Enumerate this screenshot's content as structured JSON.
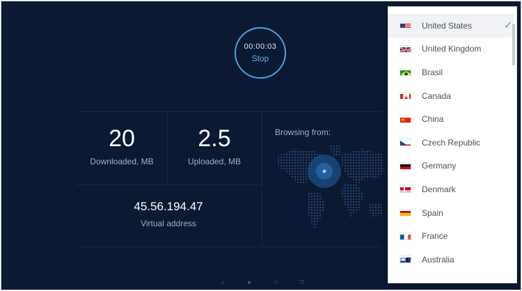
{
  "timer": {
    "time": "00:00:03",
    "stop_label": "Stop"
  },
  "stats": {
    "downloaded_value": "20",
    "downloaded_label": "Downloaded, MB",
    "uploaded_value": "2.5",
    "uploaded_label": "Uploaded, MB",
    "ip": "45.56.194.47",
    "ip_label": "Virtual address"
  },
  "browsing_from_label": "Browsing from:",
  "countries": [
    {
      "name": "United States",
      "flag": "us-flag-icon",
      "selected": true
    },
    {
      "name": "United Kingdom",
      "flag": "uk-flag-icon",
      "selected": false
    },
    {
      "name": "Brasil",
      "flag": "brazil-flag-icon",
      "selected": false
    },
    {
      "name": "Canada",
      "flag": "canada-flag-icon",
      "selected": false
    },
    {
      "name": "China",
      "flag": "china-flag-icon",
      "selected": false
    },
    {
      "name": "Czech Republic",
      "flag": "czech-flag-icon",
      "selected": false
    },
    {
      "name": "Germany",
      "flag": "germany-flag-icon",
      "selected": false
    },
    {
      "name": "Denmark",
      "flag": "denmark-flag-icon",
      "selected": false
    },
    {
      "name": "Spain",
      "flag": "spain-flag-icon",
      "selected": false
    },
    {
      "name": "France",
      "flag": "france-flag-icon",
      "selected": false
    },
    {
      "name": "Australia",
      "flag": "australia-flag-icon",
      "selected": false
    }
  ],
  "bottom_nav": [
    {
      "icon": "home-icon"
    },
    {
      "icon": "user-icon"
    },
    {
      "icon": "star-icon"
    },
    {
      "icon": "shield-icon"
    }
  ],
  "colors": {
    "background": "#0b1933",
    "accent": "#4aa3df",
    "check": "#4a90d9"
  }
}
